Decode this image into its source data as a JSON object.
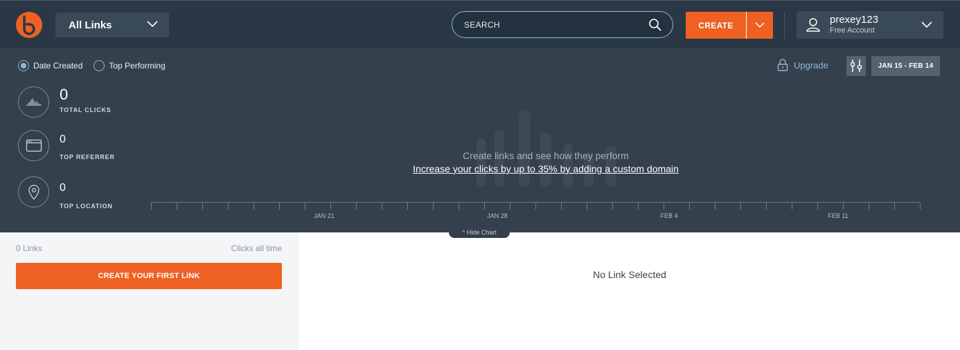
{
  "header": {
    "links_filter": "All Links",
    "search_placeholder": "SEARCH",
    "create_label": "CREATE",
    "account": {
      "username": "prexey123",
      "plan": "Free Account"
    }
  },
  "stats": {
    "radio_options": [
      {
        "label": "Date Created",
        "selected": true
      },
      {
        "label": "Top Performing",
        "selected": false
      }
    ],
    "upgrade_label": "Upgrade",
    "date_range": "JAN 15 - FEB 14",
    "metrics": [
      {
        "value": "0",
        "label": "TOTAL CLICKS"
      },
      {
        "value": "0",
        "label": "TOP REFERRER"
      },
      {
        "value": "0",
        "label": "TOP LOCATION"
      }
    ],
    "chart_message": "Create links and see how they perform",
    "chart_link": "Increase your clicks by up to 35% by adding a custom domain",
    "axis_labels": [
      "JAN 21",
      "JAN 28",
      "FEB 4",
      "FEB 11"
    ],
    "hide_chart_label": "^ Hide Chart"
  },
  "sidebar": {
    "links_count": "0 Links",
    "sort_label": "Clicks all time",
    "create_first_label": "CREATE YOUR FIRST LINK"
  },
  "detail": {
    "empty_label": "No Link Selected"
  },
  "colors": {
    "nav_bg": "#2a3846",
    "panel_bg": "#34404c",
    "accent_orange": "#ee6123",
    "accent_blue": "#8fb9d6"
  }
}
